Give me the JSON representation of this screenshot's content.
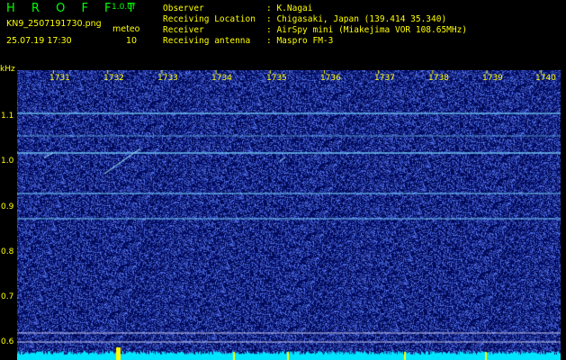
{
  "app": {
    "title": "H R O F F T",
    "version": "1.0.0f"
  },
  "file": {
    "name": "KN9_2507191730.png",
    "timestamp": "25.07.19 17:30"
  },
  "mode": {
    "label": "meteo",
    "count": "10"
  },
  "info": [
    {
      "label": "Observer",
      "value": ": K.Nagai"
    },
    {
      "label": "Receiving Location",
      "value": ": Chigasaki, Japan (139.414 35.340)"
    },
    {
      "label": "Receiver",
      "value": ": AirSpy mini (Miakejima VOR 108.65MHz)"
    },
    {
      "label": "Receiving antenna",
      "value": ": Maspro FM-3"
    }
  ],
  "axes": {
    "y_unit": "kHz",
    "time_ticks": [
      "1731",
      "1732",
      "1733",
      "1734",
      "1735",
      "1736",
      "1737",
      "1738",
      "1739",
      "1740"
    ],
    "freq_ticks": [
      "1.1",
      "1.0",
      "0.9",
      "0.8",
      "0.7",
      "0.6"
    ]
  },
  "colors": {
    "header_text": "#ffff00",
    "title": "#00ff00",
    "background": "#000f55",
    "signal": "#7fd7ff",
    "level": "#00e5ff"
  }
}
